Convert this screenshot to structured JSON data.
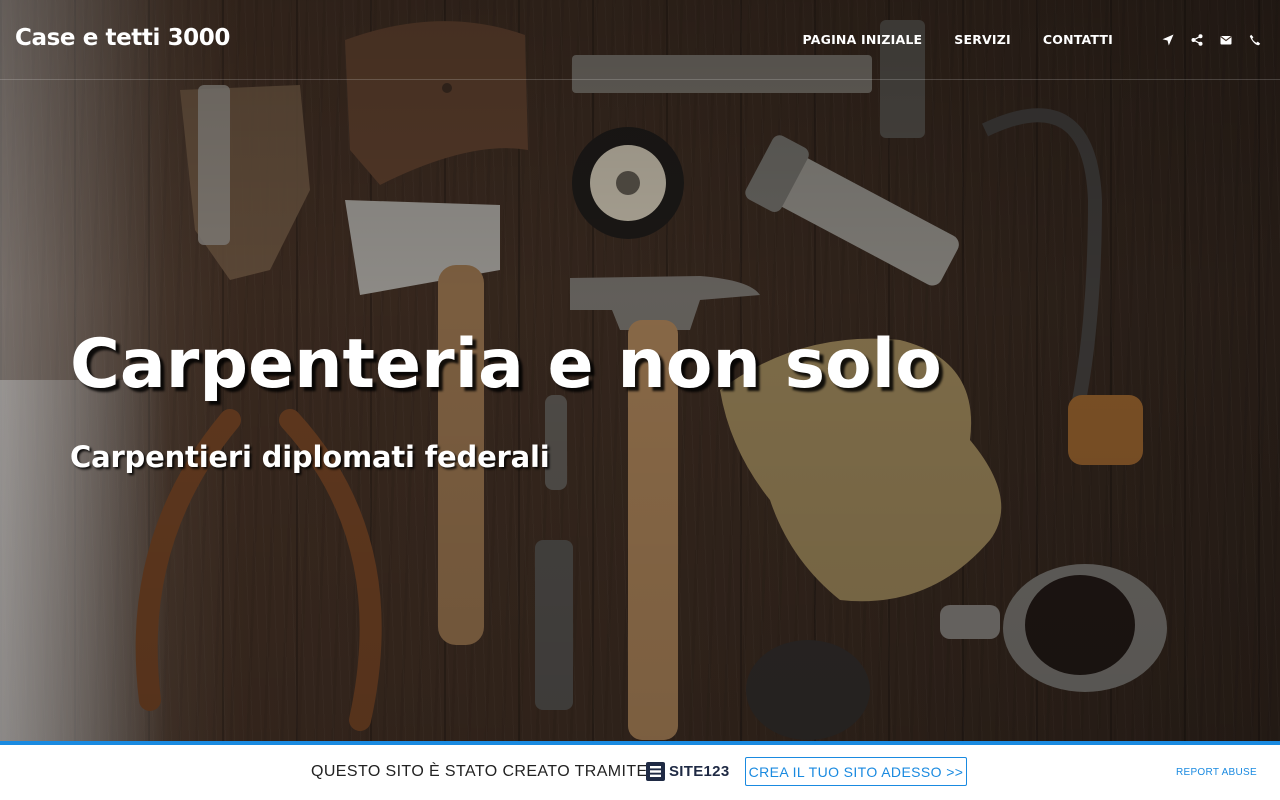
{
  "header": {
    "brand": "Case e tetti 3000",
    "nav": [
      {
        "label": "PAGINA INIZIALE"
      },
      {
        "label": "SERVIZI"
      },
      {
        "label": "CONTATTI"
      }
    ],
    "icons": [
      "location-arrow-icon",
      "share-icon",
      "envelope-icon",
      "phone-icon"
    ]
  },
  "hero": {
    "title": "Carpenteria e non solo",
    "subtitle": "Carpentieri diplomati federali",
    "background": "wooden-workbench-with-tools-photo"
  },
  "promo": {
    "text": "QUESTO SITO È STATO CREATO TRAMITE",
    "logo_text": "SITE123",
    "cta": "CREA IL TUO SITO ADESSO >>",
    "report": "REPORT ABUSE",
    "accent": "#1a8ae0"
  }
}
